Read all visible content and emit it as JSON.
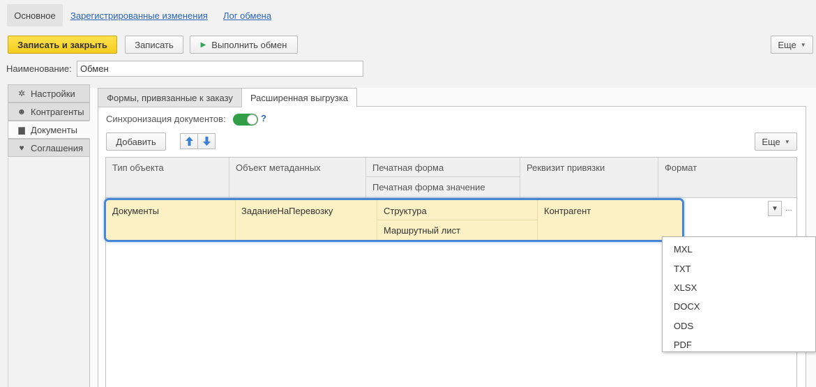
{
  "nav": {
    "active": "Основное",
    "links": [
      "Зарегистрированные изменения",
      "Лог обмена"
    ]
  },
  "toolbar": {
    "save_close": "Записать и закрыть",
    "save": "Записать",
    "run_exchange": "Выполнить обмен",
    "more": "Еще"
  },
  "name_field": {
    "label": "Наименование:",
    "value": "Обмен"
  },
  "sidetabs": [
    "Настройки",
    "Контрагенты",
    "Документы",
    "Соглашения"
  ],
  "sidetabs_active": "Документы",
  "tabs": [
    "Формы, привязанные к заказу",
    "Расширенная выгрузка"
  ],
  "tabs_active": "Расширенная выгрузка",
  "sync": {
    "label": "Синхронизация документов:",
    "enabled": true,
    "help": "?"
  },
  "list_toolbar": {
    "add": "Добавить",
    "more": "Еще"
  },
  "table": {
    "columns": [
      "Тип объекта",
      "Объект метаданных",
      "Печатная форма",
      "Реквизит привязки",
      "Формат"
    ],
    "subcolumn": "Печатная форма значение",
    "rows": [
      {
        "type": "Документы",
        "object": "ЗаданиеНаПеревозку",
        "print_form": "Структура",
        "print_form_value": "Маршрутный лист",
        "attribute": "Контрагент",
        "format": ""
      }
    ]
  },
  "format_options": [
    "MXL",
    "TXT",
    "XLSX",
    "DOCX",
    "ODS",
    "PDF"
  ],
  "colors": {
    "primary_button": "#f4cd1f",
    "selection_row": "#fcf1c4",
    "selection_border": "#4a86d8",
    "toggle_on": "#2f9e44",
    "link": "#2a63b8"
  },
  "icons": {
    "settings": "gear-icon",
    "contractors": "people-icon",
    "documents": "document-icon",
    "agreements": "handshake-icon",
    "run": "play-icon",
    "up": "arrow-up-icon",
    "down": "arrow-down-icon"
  }
}
